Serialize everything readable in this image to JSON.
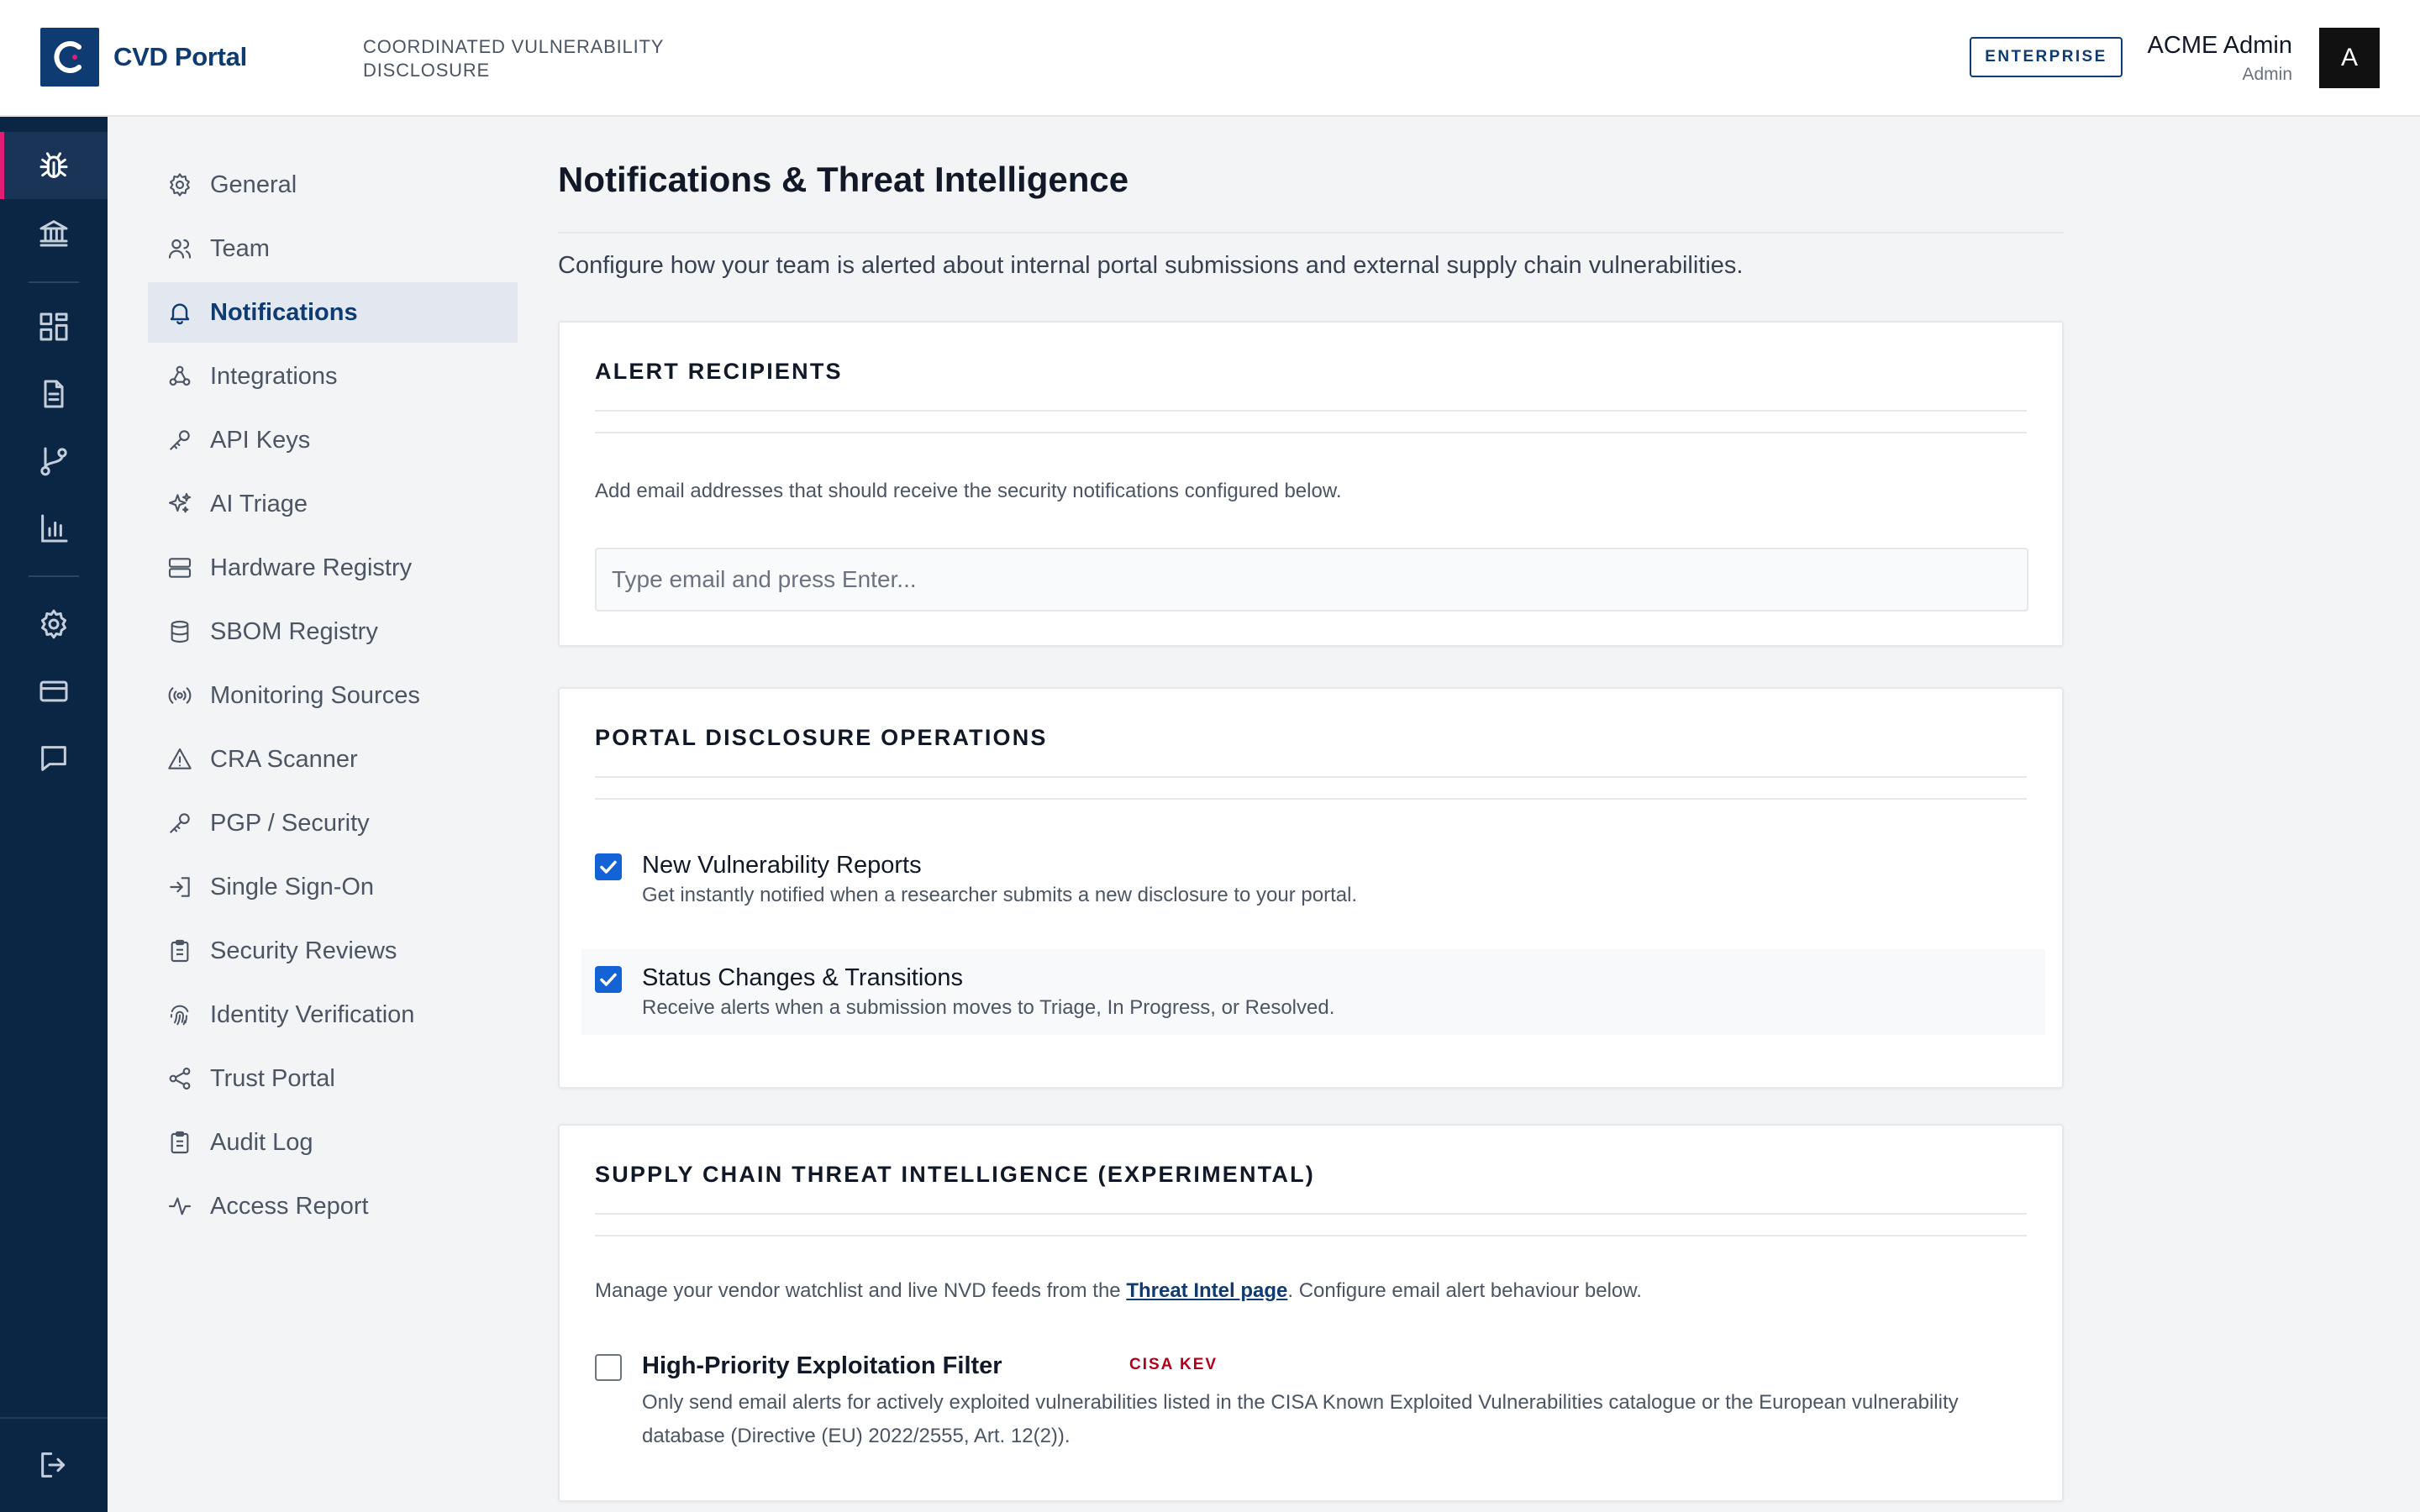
{
  "header": {
    "brand_name": "CVD Portal",
    "brand_subtitle": "COORDINATED VULNERABILITY DISCLOSURE",
    "plan_badge": "ENTERPRISE",
    "user_name": "ACME Admin",
    "user_role": "Admin",
    "avatar_initial": "A"
  },
  "rail": {
    "items": [
      {
        "icon": "bug-icon",
        "active": true
      },
      {
        "icon": "bank-icon",
        "active": false
      },
      {
        "icon": "dashboard-grid-icon",
        "active": false
      },
      {
        "icon": "document-icon",
        "active": false
      },
      {
        "icon": "git-branch-icon",
        "active": false
      },
      {
        "icon": "bar-chart-icon",
        "active": false
      },
      {
        "icon": "gear-icon",
        "active": false
      },
      {
        "icon": "credit-card-icon",
        "active": false
      },
      {
        "icon": "chat-bubble-icon",
        "active": false
      },
      {
        "icon": "logout-icon",
        "active": false
      }
    ]
  },
  "settings_nav": {
    "items": [
      {
        "label": "General",
        "icon": "gear-icon"
      },
      {
        "label": "Team",
        "icon": "users-icon"
      },
      {
        "label": "Notifications",
        "icon": "bell-icon",
        "active": true
      },
      {
        "label": "Integrations",
        "icon": "webhook-icon"
      },
      {
        "label": "API Keys",
        "icon": "key-icon"
      },
      {
        "label": "AI Triage",
        "icon": "sparkles-icon"
      },
      {
        "label": "Hardware Registry",
        "icon": "server-icon"
      },
      {
        "label": "SBOM Registry",
        "icon": "database-icon"
      },
      {
        "label": "Monitoring Sources",
        "icon": "radio-icon"
      },
      {
        "label": "CRA Scanner",
        "icon": "warning-triangle-icon"
      },
      {
        "label": "PGP / Security",
        "icon": "key-icon"
      },
      {
        "label": "Single Sign-On",
        "icon": "login-icon"
      },
      {
        "label": "Security Reviews",
        "icon": "clipboard-icon"
      },
      {
        "label": "Identity Verification",
        "icon": "fingerprint-icon"
      },
      {
        "label": "Trust Portal",
        "icon": "share-icon"
      },
      {
        "label": "Audit Log",
        "icon": "clipboard-icon"
      },
      {
        "label": "Access Report",
        "icon": "activity-icon"
      }
    ]
  },
  "main": {
    "title": "Notifications & Threat Intelligence",
    "description": "Configure how your team is alerted about internal portal submissions and external supply chain vulnerabilities.",
    "alert_recipients": {
      "title": "ALERT RECIPIENTS",
      "help_text": "Add email addresses that should receive the security notifications configured below.",
      "email_placeholder": "Type email and press Enter...",
      "email_value": ""
    },
    "portal_ops": {
      "title": "PORTAL DISCLOSURE OPERATIONS",
      "options": [
        {
          "label": "New Vulnerability Reports",
          "description": "Get instantly notified when a researcher submits a new disclosure to your portal.",
          "checked": true
        },
        {
          "label": "Status Changes & Transitions",
          "description": "Receive alerts when a submission moves to Triage, In Progress, or Resolved.",
          "checked": true
        }
      ]
    },
    "threat_intel": {
      "title": "SUPPLY CHAIN THREAT INTELLIGENCE (EXPERIMENTAL)",
      "text_before_link": "Manage your vendor watchlist and live NVD feeds from the ",
      "link_text": "Threat Intel page",
      "text_after_link": ". Configure email alert behaviour below.",
      "filter_option": {
        "label": "High-Priority Exploitation Filter",
        "badge": "CISA KEV",
        "description": "Only send email alerts for actively exploited vulnerabilities listed in the CISA Known Exploited Vulnerabilities catalogue or the European vulnerability database (Directive (EU) 2022/2555, Art. 12(2)).",
        "checked": false
      }
    }
  },
  "colors": {
    "brand": "#0f3b73",
    "rail_bg": "#0b2545",
    "rail_active_accent": "#e11d74",
    "checkbox_checked": "#1363d6",
    "kev_badge": "#b3001b",
    "page_bg": "#f3f4f6"
  }
}
